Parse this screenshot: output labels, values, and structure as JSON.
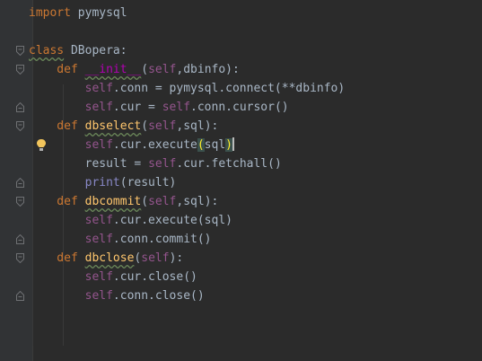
{
  "editor": {
    "lines": [
      {
        "tokens": [
          [
            "kw",
            "import"
          ],
          [
            "plain",
            " pymysql"
          ]
        ]
      },
      {
        "tokens": []
      },
      {
        "tokens": [
          [
            "kw",
            "class"
          ],
          [
            "plain",
            " DBopera:"
          ]
        ]
      },
      {
        "tokens": [
          [
            "kw",
            "    def "
          ],
          [
            "magic",
            "__init__"
          ],
          [
            "plain",
            "("
          ],
          [
            "self",
            "self"
          ],
          [
            "plain",
            ",dbinfo):"
          ]
        ]
      },
      {
        "tokens": [
          [
            "self",
            "        self"
          ],
          [
            "plain",
            ".conn = pymysql.connect(**dbinfo)"
          ]
        ]
      },
      {
        "tokens": [
          [
            "self",
            "        self"
          ],
          [
            "plain",
            ".cur = "
          ],
          [
            "self",
            "self"
          ],
          [
            "plain",
            ".conn.cursor()"
          ]
        ]
      },
      {
        "tokens": [
          [
            "kw",
            "    def "
          ],
          [
            "fn",
            "dbselect"
          ],
          [
            "plain",
            "("
          ],
          [
            "self",
            "self"
          ],
          [
            "plain",
            ",sql):"
          ]
        ]
      },
      {
        "tokens": [
          [
            "self",
            "        self"
          ],
          [
            "plain",
            ".cur.execute"
          ],
          [
            "hi",
            "("
          ],
          [
            "plain",
            "sql"
          ],
          [
            "hi",
            ")"
          ]
        ]
      },
      {
        "tokens": [
          [
            "plain",
            "        result = "
          ],
          [
            "self",
            "self"
          ],
          [
            "plain",
            ".cur.fetchall()"
          ]
        ]
      },
      {
        "tokens": [
          [
            "builtin",
            "        print"
          ],
          [
            "plain",
            "(result)"
          ]
        ]
      },
      {
        "tokens": [
          [
            "kw",
            "    def "
          ],
          [
            "fn",
            "dbcommit"
          ],
          [
            "plain",
            "("
          ],
          [
            "self",
            "self"
          ],
          [
            "plain",
            ",sql):"
          ]
        ]
      },
      {
        "tokens": [
          [
            "self",
            "        self"
          ],
          [
            "plain",
            ".cur.execute(sql)"
          ]
        ]
      },
      {
        "tokens": [
          [
            "self",
            "        self"
          ],
          [
            "plain",
            ".conn.commit()"
          ]
        ]
      },
      {
        "tokens": [
          [
            "kw",
            "    def "
          ],
          [
            "fn",
            "dbclose"
          ],
          [
            "plain",
            "("
          ],
          [
            "self",
            "self"
          ],
          [
            "plain",
            "):"
          ]
        ]
      },
      {
        "tokens": [
          [
            "self",
            "        self"
          ],
          [
            "plain",
            ".cur.close()"
          ]
        ]
      },
      {
        "tokens": [
          [
            "self",
            "        self"
          ],
          [
            "plain",
            ".conn.close()"
          ]
        ]
      }
    ],
    "colors": {
      "background": "#2b2b2b",
      "gutter": "#313335",
      "keyword": "#cc7832",
      "self": "#94558d",
      "function": "#ffc66d",
      "magic": "#b200b2",
      "builtin": "#8888c6",
      "plain": "#a9b7c6",
      "bracket_highlight": "#ffef28",
      "intention_bulb": "#f2c55c"
    },
    "icons": {
      "intention": "lightbulb-icon",
      "fold": "fold-marker-icon"
    }
  }
}
